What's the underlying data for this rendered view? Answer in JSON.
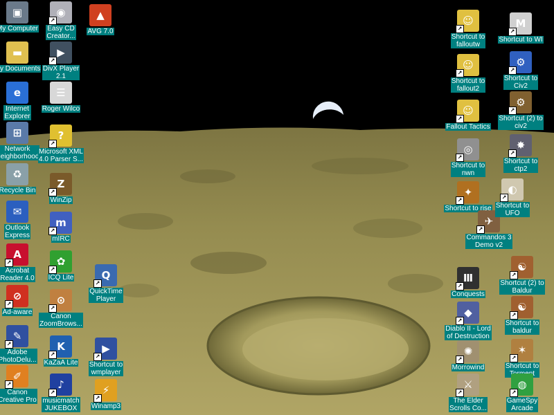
{
  "colors": {
    "label_background": "#008080",
    "label_text": "#ffffff",
    "sky": "#000000",
    "moon_surface": "#a59a55"
  },
  "icons": [
    {
      "label": "My Computer",
      "icon": "computer-icon",
      "shortcut": false,
      "color": "#6a7a8a"
    },
    {
      "label": "My Documents",
      "icon": "folder-icon",
      "shortcut": false,
      "color": "#e0c050"
    },
    {
      "label": "Internet\nExplorer",
      "icon": "internet-explorer-icon",
      "shortcut": false,
      "color": "#2a6fd6"
    },
    {
      "label": "Network\nNeighborhood",
      "icon": "network-icon",
      "shortcut": false,
      "color": "#5a7aa8"
    },
    {
      "label": "Recycle Bin",
      "icon": "recycle-bin-icon",
      "shortcut": false,
      "color": "#8aa0a8"
    },
    {
      "label": "Outlook\nExpress",
      "icon": "outlook-express-icon",
      "shortcut": false,
      "color": "#2b5fbf"
    },
    {
      "label": "Acrobat\nReader 4.0",
      "icon": "acrobat-icon",
      "shortcut": true,
      "color": "#c8102e"
    },
    {
      "label": "Ad-aware",
      "icon": "adaware-icon",
      "shortcut": true,
      "color": "#d03020"
    },
    {
      "label": "Adobe\nPhotoDelu...",
      "icon": "photodeluxe-icon",
      "shortcut": true,
      "color": "#3050a0"
    },
    {
      "label": "Canon\nCreative Pro",
      "icon": "canon-creative-icon",
      "shortcut": true,
      "color": "#e08020"
    },
    {
      "label": "Easy CD\nCreator...",
      "icon": "cd-icon",
      "shortcut": true,
      "color": "#b0b0b8"
    },
    {
      "label": "DivX Player\n2.1",
      "icon": "divx-icon",
      "shortcut": true,
      "color": "#405060"
    },
    {
      "label": "Roger Wilco",
      "icon": "roger-wilco-icon",
      "shortcut": false,
      "color": "#d8d8d8"
    },
    {
      "label": "Microsoft XML\n4.0 Parser S...",
      "icon": "help-icon",
      "shortcut": true,
      "color": "#e0c030"
    },
    {
      "label": "WinZip",
      "icon": "winzip-icon",
      "shortcut": true,
      "color": "#7a5a2a"
    },
    {
      "label": "mIRC",
      "icon": "mirc-icon",
      "shortcut": true,
      "color": "#4060c0"
    },
    {
      "label": "ICQ Lite",
      "icon": "icq-icon",
      "shortcut": true,
      "color": "#30a030"
    },
    {
      "label": "Canon\nZoomBrows...",
      "icon": "canon-zoom-icon",
      "shortcut": true,
      "color": "#c08040"
    },
    {
      "label": "KaZaA Lite",
      "icon": "kazaa-icon",
      "shortcut": true,
      "color": "#2060b0"
    },
    {
      "label": "musicmatch\nJUKEBOX",
      "icon": "musicmatch-icon",
      "shortcut": true,
      "color": "#2040a0"
    },
    {
      "label": "AVG 7.0",
      "icon": "avg-icon",
      "shortcut": false,
      "color": "#d04020"
    },
    {
      "label": "QuickTime\nPlayer",
      "icon": "quicktime-icon",
      "shortcut": true,
      "color": "#3a6ab0"
    },
    {
      "label": "Shortcut to\nwmplayer",
      "icon": "wmplayer-icon",
      "shortcut": true,
      "color": "#3050a0"
    },
    {
      "label": "Winamp3",
      "icon": "winamp-icon",
      "shortcut": true,
      "color": "#e0a020"
    },
    {
      "label": "Shortcut to\nfalloutw",
      "icon": "vault-boy-icon",
      "shortcut": true,
      "color": "#e0c040"
    },
    {
      "label": "Shortcut to\nfallout2",
      "icon": "vault-boy-icon",
      "shortcut": true,
      "color": "#e0c040"
    },
    {
      "label": "Fallout Tactics",
      "icon": "vault-boy-icon",
      "shortcut": true,
      "color": "#e0c040"
    },
    {
      "label": "Shortcut to\nnwn",
      "icon": "nwn-icon",
      "shortcut": true,
      "color": "#909090"
    },
    {
      "label": "Shortcut to rise",
      "icon": "rise-icon",
      "shortcut": true,
      "color": "#b07020"
    },
    {
      "label": "Commandos 3\nDemo v2",
      "icon": "commandos-icon",
      "shortcut": true,
      "color": "#806040"
    },
    {
      "label": "Conquests",
      "icon": "conquests-icon",
      "shortcut": true,
      "color": "#303030"
    },
    {
      "label": "Diablo II - Lord\nof Destruction",
      "icon": "diablo-icon",
      "shortcut": true,
      "color": "#5060a0"
    },
    {
      "label": "Morrowind",
      "icon": "morrowind-icon",
      "shortcut": true,
      "color": "#a09070"
    },
    {
      "label": "The Elder\nScrolls Co...",
      "icon": "elder-scrolls-icon",
      "shortcut": true,
      "color": "#b0a080"
    },
    {
      "label": "Shortcut to WI",
      "icon": "ms-icon",
      "shortcut": true,
      "color": "#d0d0d0"
    },
    {
      "label": "Shortcut to\nCiv2",
      "icon": "civ2-icon",
      "shortcut": true,
      "color": "#3060c0"
    },
    {
      "label": "Shortcut (2) to\nciv2",
      "icon": "civ2-icon",
      "shortcut": true,
      "color": "#806030"
    },
    {
      "label": "Shortcut to\nctp2",
      "icon": "ctp2-icon",
      "shortcut": true,
      "color": "#606070"
    },
    {
      "label": "Shortcut to\nUFO",
      "icon": "ufo-icon",
      "shortcut": true,
      "color": "#d0c8b0"
    },
    {
      "label": "Shortcut (2) to\nBaldur",
      "icon": "baldur-icon",
      "shortcut": true,
      "color": "#a06030"
    },
    {
      "label": "Shortcut to\nbaldur",
      "icon": "baldur-icon",
      "shortcut": true,
      "color": "#a06030"
    },
    {
      "label": "Shortcut to\nTorment",
      "icon": "torment-icon",
      "shortcut": true,
      "color": "#b08040"
    },
    {
      "label": "GameSpy\nArcade",
      "icon": "gamespy-icon",
      "shortcut": true,
      "color": "#30a040"
    }
  ]
}
